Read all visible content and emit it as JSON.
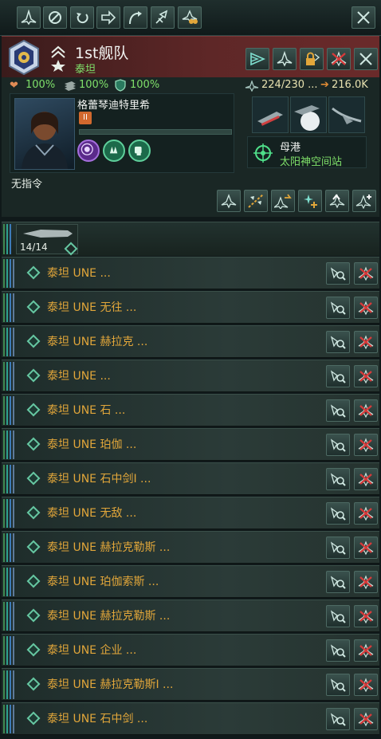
{
  "toolbar": {
    "icons": [
      "fleet-icon",
      "no-entry-icon",
      "return-icon",
      "move-arrow-icon",
      "orbit-arrow-icon",
      "merge-icon",
      "binoculars-icon"
    ],
    "close": "close-icon"
  },
  "fleet": {
    "name": "1st舰队",
    "faction": "泰坦",
    "actions": [
      "move-fleet-icon",
      "ship-design-icon",
      "lock-icon",
      "disband-icon",
      "close-icon"
    ]
  },
  "stats": {
    "hull": "100%",
    "armor": "100%",
    "shield": "100%",
    "capacity": "224/230 ...",
    "power": "216.0K"
  },
  "admiral": {
    "name": "格蕾琴迪特里希",
    "rank": "II",
    "traits": [
      "psionic-icon",
      "fleet-organizer-icon",
      "fist-icon"
    ],
    "order": "无指令"
  },
  "home": {
    "label": "母港",
    "station": "太阳神空间站"
  },
  "actionbar": [
    "upgrade-fleet-icon",
    "split-icon",
    "reinforce-icon",
    "sparkle-add-icon",
    "upgrade-arrow-icon",
    "add-ship-icon"
  ],
  "group": {
    "count": "14/14"
  },
  "ships": [
    "泰坦 UNE ...",
    "泰坦 UNE 无往 ...",
    "泰坦 UNE 赫拉克 ...",
    "泰坦 UNE ...",
    "泰坦 UNE 石 ...",
    "泰坦 UNE 珀伽 ...",
    "泰坦 UNE 石中剑I ...",
    "泰坦 UNE 无敌 ...",
    "泰坦 UNE 赫拉克勒斯 ...",
    "泰坦 UNE 珀伽索斯 ...",
    "泰坦 UNE 赫拉克勒斯 ...",
    "泰坦 UNE 企业 ...",
    "泰坦 UNE 赫拉克勒斯I ...",
    "泰坦 UNE 石中剑 ..."
  ],
  "colors": {
    "accent": "#e1a63a",
    "green": "#7fe06a",
    "red": "#d63a3a"
  }
}
